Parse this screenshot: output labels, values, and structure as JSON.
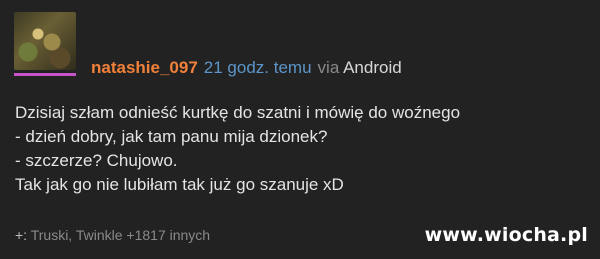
{
  "post": {
    "username": "natashie_097",
    "time_ago": "21 godz. temu",
    "via_label": "via",
    "platform": "Android",
    "lines": [
      "Dzisiaj szłam odnieść kurtkę do szatni i mówię do woźnego",
      "- dzień dobry, jak tam panu mija dzionek?",
      "- szczerze? Chujowo.",
      "Tak jak go nie lubiłam tak już go szanuje xD"
    ],
    "likes_prefix": "+:",
    "likes_text": "Truski, Twinkle +1817 innych"
  },
  "watermark": "www.wiocha.pl",
  "colors": {
    "background": "#222222",
    "username": "#f0803a",
    "time": "#5c95c8",
    "avatar_bar": "#c653c9"
  }
}
